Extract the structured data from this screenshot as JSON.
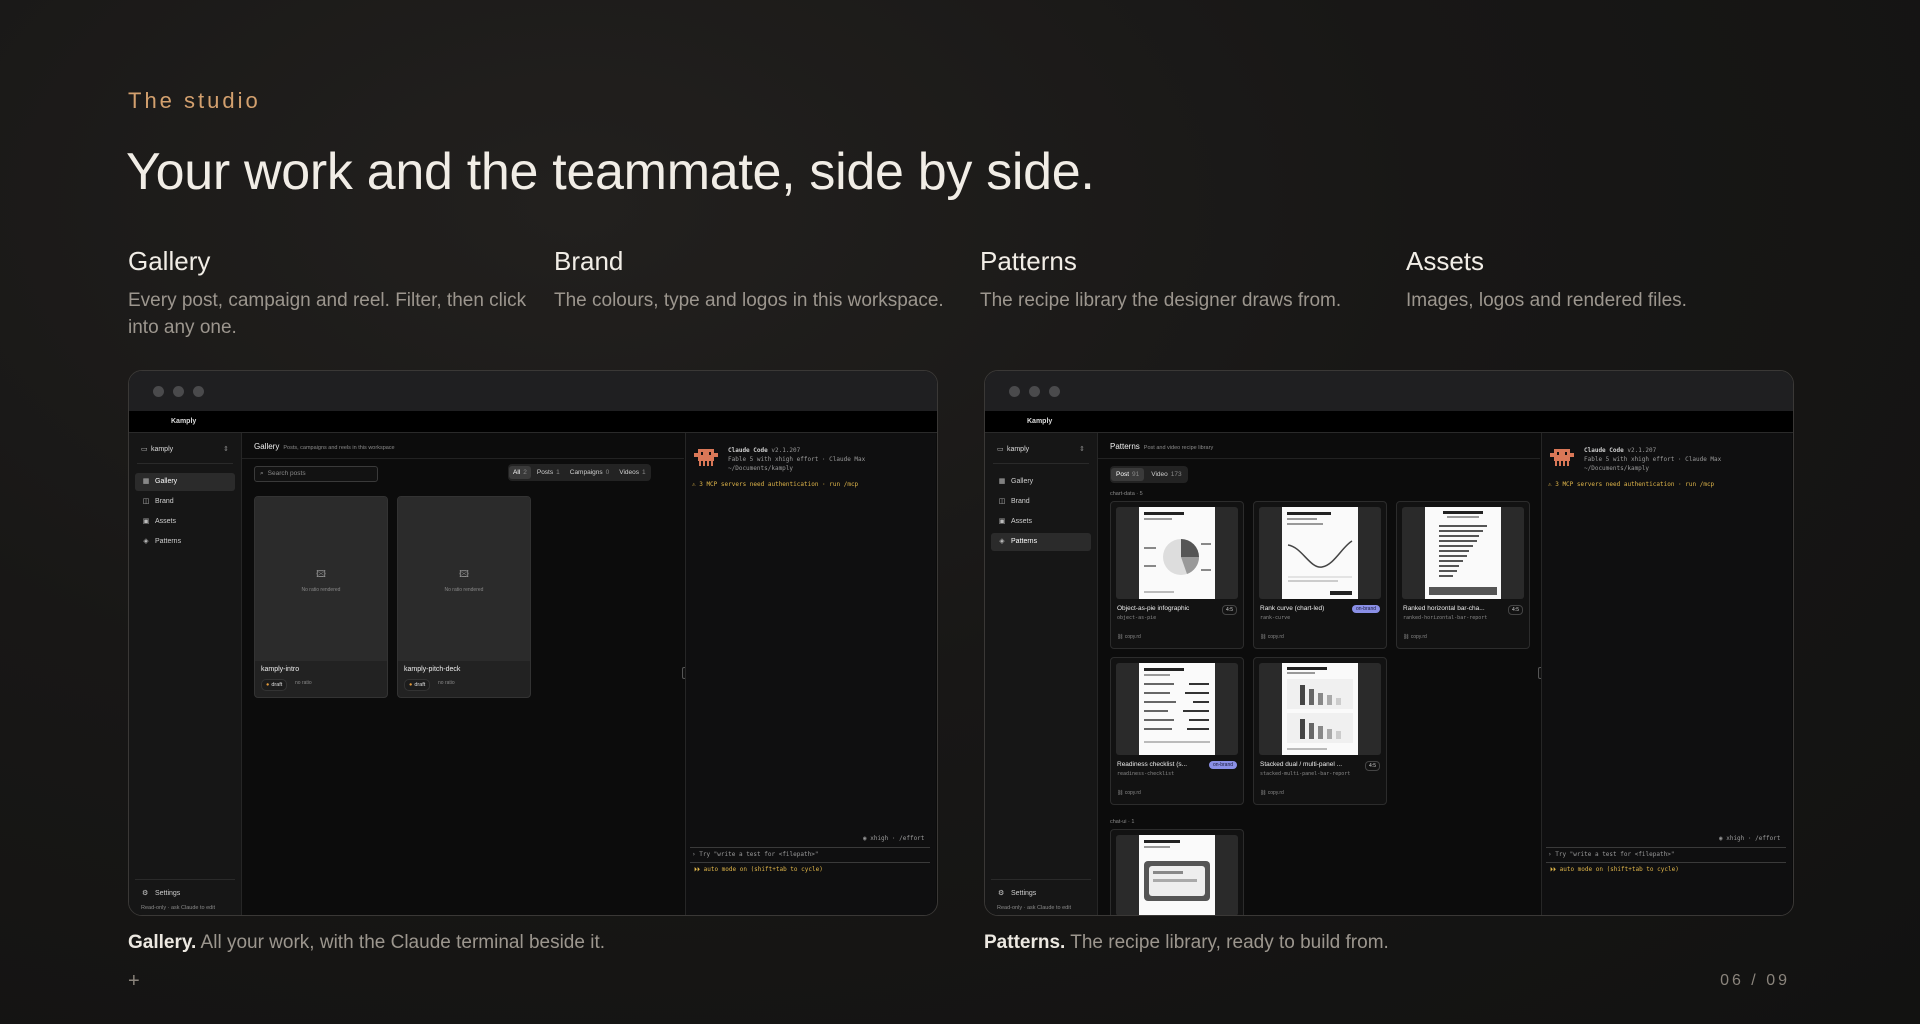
{
  "eyebrow": "The studio",
  "headline": "Your work and the teammate, side by side.",
  "columns": [
    {
      "title": "Gallery",
      "desc": "Every post, campaign and reel. Filter, then click into any one."
    },
    {
      "title": "Brand",
      "desc": "The colours, type and logos in this workspace."
    },
    {
      "title": "Patterns",
      "desc": "The recipe library the designer draws from."
    },
    {
      "title": "Assets",
      "desc": "Images, logos and rendered files."
    }
  ],
  "app": {
    "title": "Kamply",
    "workspace": "kamply",
    "nav": [
      "Gallery",
      "Brand",
      "Assets",
      "Patterns"
    ],
    "settings": "Settings",
    "readonly": "Read-only · ask Claude to edit"
  },
  "gallery": {
    "title": "Gallery",
    "subtitle": "Posts, campaigns and reels in this workspace",
    "search_placeholder": "Search posts",
    "filters": [
      {
        "label": "All",
        "count": "2"
      },
      {
        "label": "Posts",
        "count": "1"
      },
      {
        "label": "Campaigns",
        "count": "0"
      },
      {
        "label": "Videos",
        "count": "1"
      }
    ],
    "no_ratio": "No ratio rendered",
    "cards": [
      {
        "title": "kamply-intro",
        "status": "draft",
        "ratio": "no ratio"
      },
      {
        "title": "kamply-pitch-deck",
        "status": "draft",
        "ratio": "no ratio"
      }
    ]
  },
  "patterns": {
    "title": "Patterns",
    "subtitle": "Post and video recipe library",
    "tabs": [
      {
        "label": "Post",
        "count": "91"
      },
      {
        "label": "Video",
        "count": "173"
      }
    ],
    "group1": "chart-data · 5",
    "group2": "chat-ui · 1",
    "cards": [
      {
        "title": "Object-as-pie infographic",
        "slug": "object-as-pie",
        "badge": "4:5",
        "copy": "copy.rd"
      },
      {
        "title": "Rank curve (chart-led)",
        "slug": "rank-curve",
        "badge": "on-brand",
        "copy": "copy.rd"
      },
      {
        "title": "Ranked horizontal bar-cha...",
        "slug": "ranked-horizontal-bar-report",
        "badge": "4:5",
        "copy": "copy.rd"
      },
      {
        "title": "Readiness checklist (s...",
        "slug": "readiness-checklist",
        "badge": "on-brand",
        "copy": "copy.rd"
      },
      {
        "title": "Stacked dual / multi-panel ...",
        "slug": "stacked-multi-panel-bar-report",
        "badge": "4:5",
        "copy": "copy.rd"
      }
    ]
  },
  "terminal": {
    "app": "Claude Code",
    "version": "v2.1.207",
    "line2": "Fable 5 with xhigh effort · Claude Max",
    "line3": "~/Documents/kamply",
    "warn": "⚠ 3 MCP servers need authentication · run /mcp",
    "effort": "◉ xhigh · /effort",
    "prompt": "Try \"write a test for <filepath>\"",
    "mode": "⏵⏵ auto mode on (shift+tab to cycle)"
  },
  "captions": [
    {
      "bold": "Gallery.",
      "text": "All your work, with the Claude terminal beside it."
    },
    {
      "bold": "Patterns.",
      "text": "The recipe library, ready to build from."
    }
  ],
  "pager": "06 / 09",
  "colors": {
    "accent": "#d3a06e",
    "onbrand": "#8a8fe6",
    "warn": "#e0b64a",
    "claude": "#d97757"
  }
}
